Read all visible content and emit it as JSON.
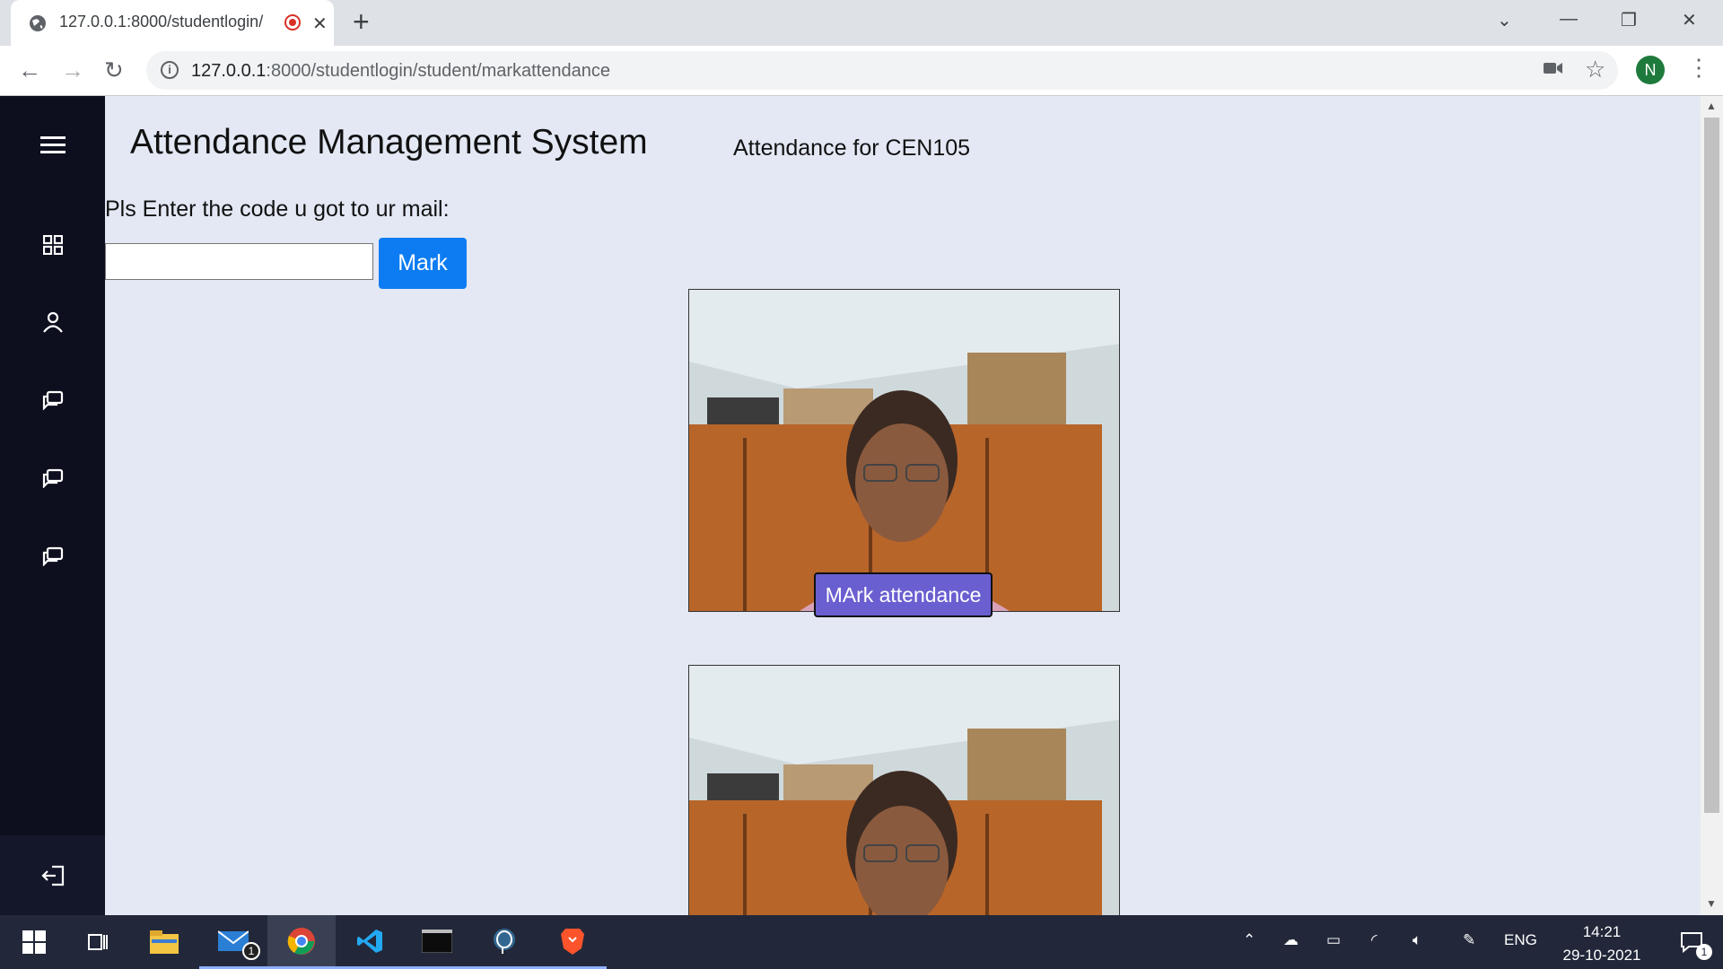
{
  "browser": {
    "tab_title": "127.0.0.1:8000/studentlogin/",
    "url_host": "127.0.0.1",
    "url_path": ":8000/studentlogin/student/markattendance",
    "profile_initial": "N"
  },
  "app": {
    "title": "Attendance Management System",
    "course_heading": "Attendance for CEN105",
    "code_prompt": "Pls Enter the code u got to ur mail:",
    "code_value": "",
    "mark_button": "Mark",
    "mark_attendance_button": "MArk attendance"
  },
  "sidebar": {
    "items": [
      "menu-icon",
      "grid-icon",
      "user-icon",
      "chat-icon",
      "chat-icon",
      "chat-icon"
    ],
    "signout": "logout-icon"
  },
  "taskbar": {
    "mail_badge": "1",
    "language": "ENG",
    "time": "14:21",
    "date": "29-10-2021",
    "notification_badge": "1"
  },
  "colors": {
    "mark_button": "#0d7cf2",
    "attend_button": "#6a5fd0",
    "sidebar": "#0d0f1f",
    "page_bg": "#e3e8f4"
  }
}
